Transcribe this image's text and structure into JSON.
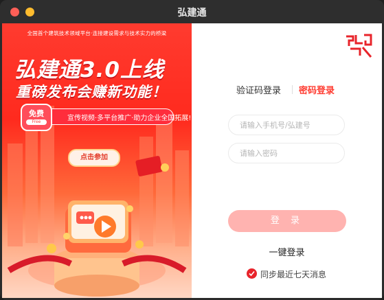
{
  "window": {
    "title": "弘建通"
  },
  "banner": {
    "tagline": "全国首个建筑技术领域平台·连接建设需求与技术实力的桥梁",
    "headline_line1": "弘建通3.0上线",
    "headline_line2": "重磅发布会赚新功能！",
    "free_badge_cn": "免费",
    "free_badge_en": "Free",
    "promo_text": "宣传视频·多平台推广·助力企业全国拓展!",
    "join_button": "点击参加"
  },
  "login": {
    "tabs": [
      {
        "label": "验证码登录",
        "active": false
      },
      {
        "label": "密码登录",
        "active": true
      }
    ],
    "phone_placeholder": "请输入手机号/弘建号",
    "password_placeholder": "请输入密码",
    "login_button": "登 录",
    "one_key_login": "一键登录",
    "sync_label": "同步最近七天消息",
    "sync_checked": true
  },
  "colors": {
    "accent": "#ff3b30",
    "login_button_bg": "#ffb3b0",
    "banner_red": "#ff2a1e"
  }
}
